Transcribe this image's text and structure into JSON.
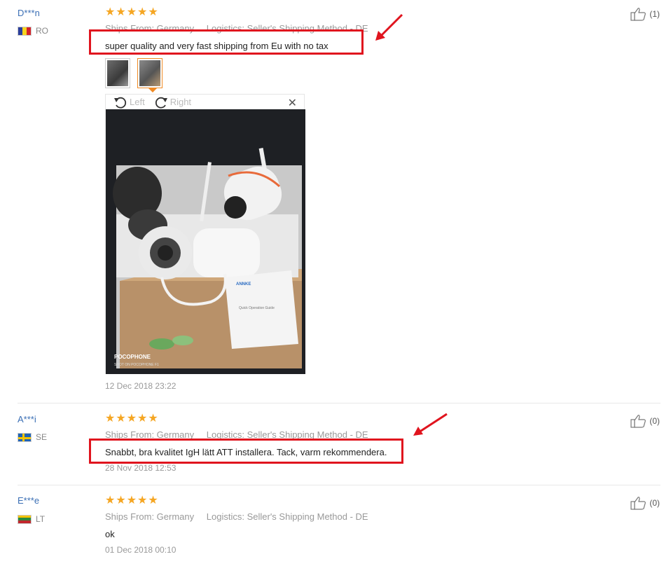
{
  "reviews": [
    {
      "user": "D***n",
      "country": "RO",
      "stars": 5,
      "ships_from": "Ships From: Germany",
      "logistics": "Logistics: Seller's Shipping Method - DE",
      "text": "super quality and very fast shipping from Eu with no tax",
      "date": "12 Dec 2018 23:22",
      "helpful": "(1)",
      "flag_colors": [
        "#2b3f9c",
        "#f6d41e",
        "#d4232a"
      ]
    },
    {
      "user": "A***i",
      "country": "SE",
      "stars": 5,
      "ships_from": "Ships From: Germany",
      "logistics": "Logistics: Seller's Shipping Method - DE",
      "text": "Snabbt, bra kvalitet IgH lätt ATT installera. Tack, varm rekommendera.",
      "date": "28 Nov 2018 12:53",
      "helpful": "(0)",
      "flag_colors": [
        "#1f63b5",
        "#f3c400"
      ]
    },
    {
      "user": "E***e",
      "country": "LT",
      "stars": 5,
      "ships_from": "Ships From: Germany",
      "logistics": "Logistics: Seller's Shipping Method - DE",
      "text": "ok",
      "date": "01 Dec 2018 00:10",
      "helpful": "(0)",
      "flag_colors": [
        "#f8c300",
        "#2a8a3e",
        "#c1272d"
      ]
    }
  ],
  "viewer": {
    "rotate_left": "Left",
    "rotate_right": "Right",
    "close": "✕",
    "photo_brand": "POCOPHONE",
    "photo_subtitle": "SHOT ON POCOPHONE F1",
    "product_label": "ANNKE",
    "guide_title": "Quick Operation Guide"
  },
  "colors": {
    "star": "#f5a623",
    "highlight": "#e0141e",
    "username": "#3b6fb5"
  },
  "icons": {
    "helpful": "thumbs-up-icon",
    "rotate_left": "rotate-left-icon",
    "rotate_right": "rotate-right-icon",
    "close": "close-icon"
  }
}
